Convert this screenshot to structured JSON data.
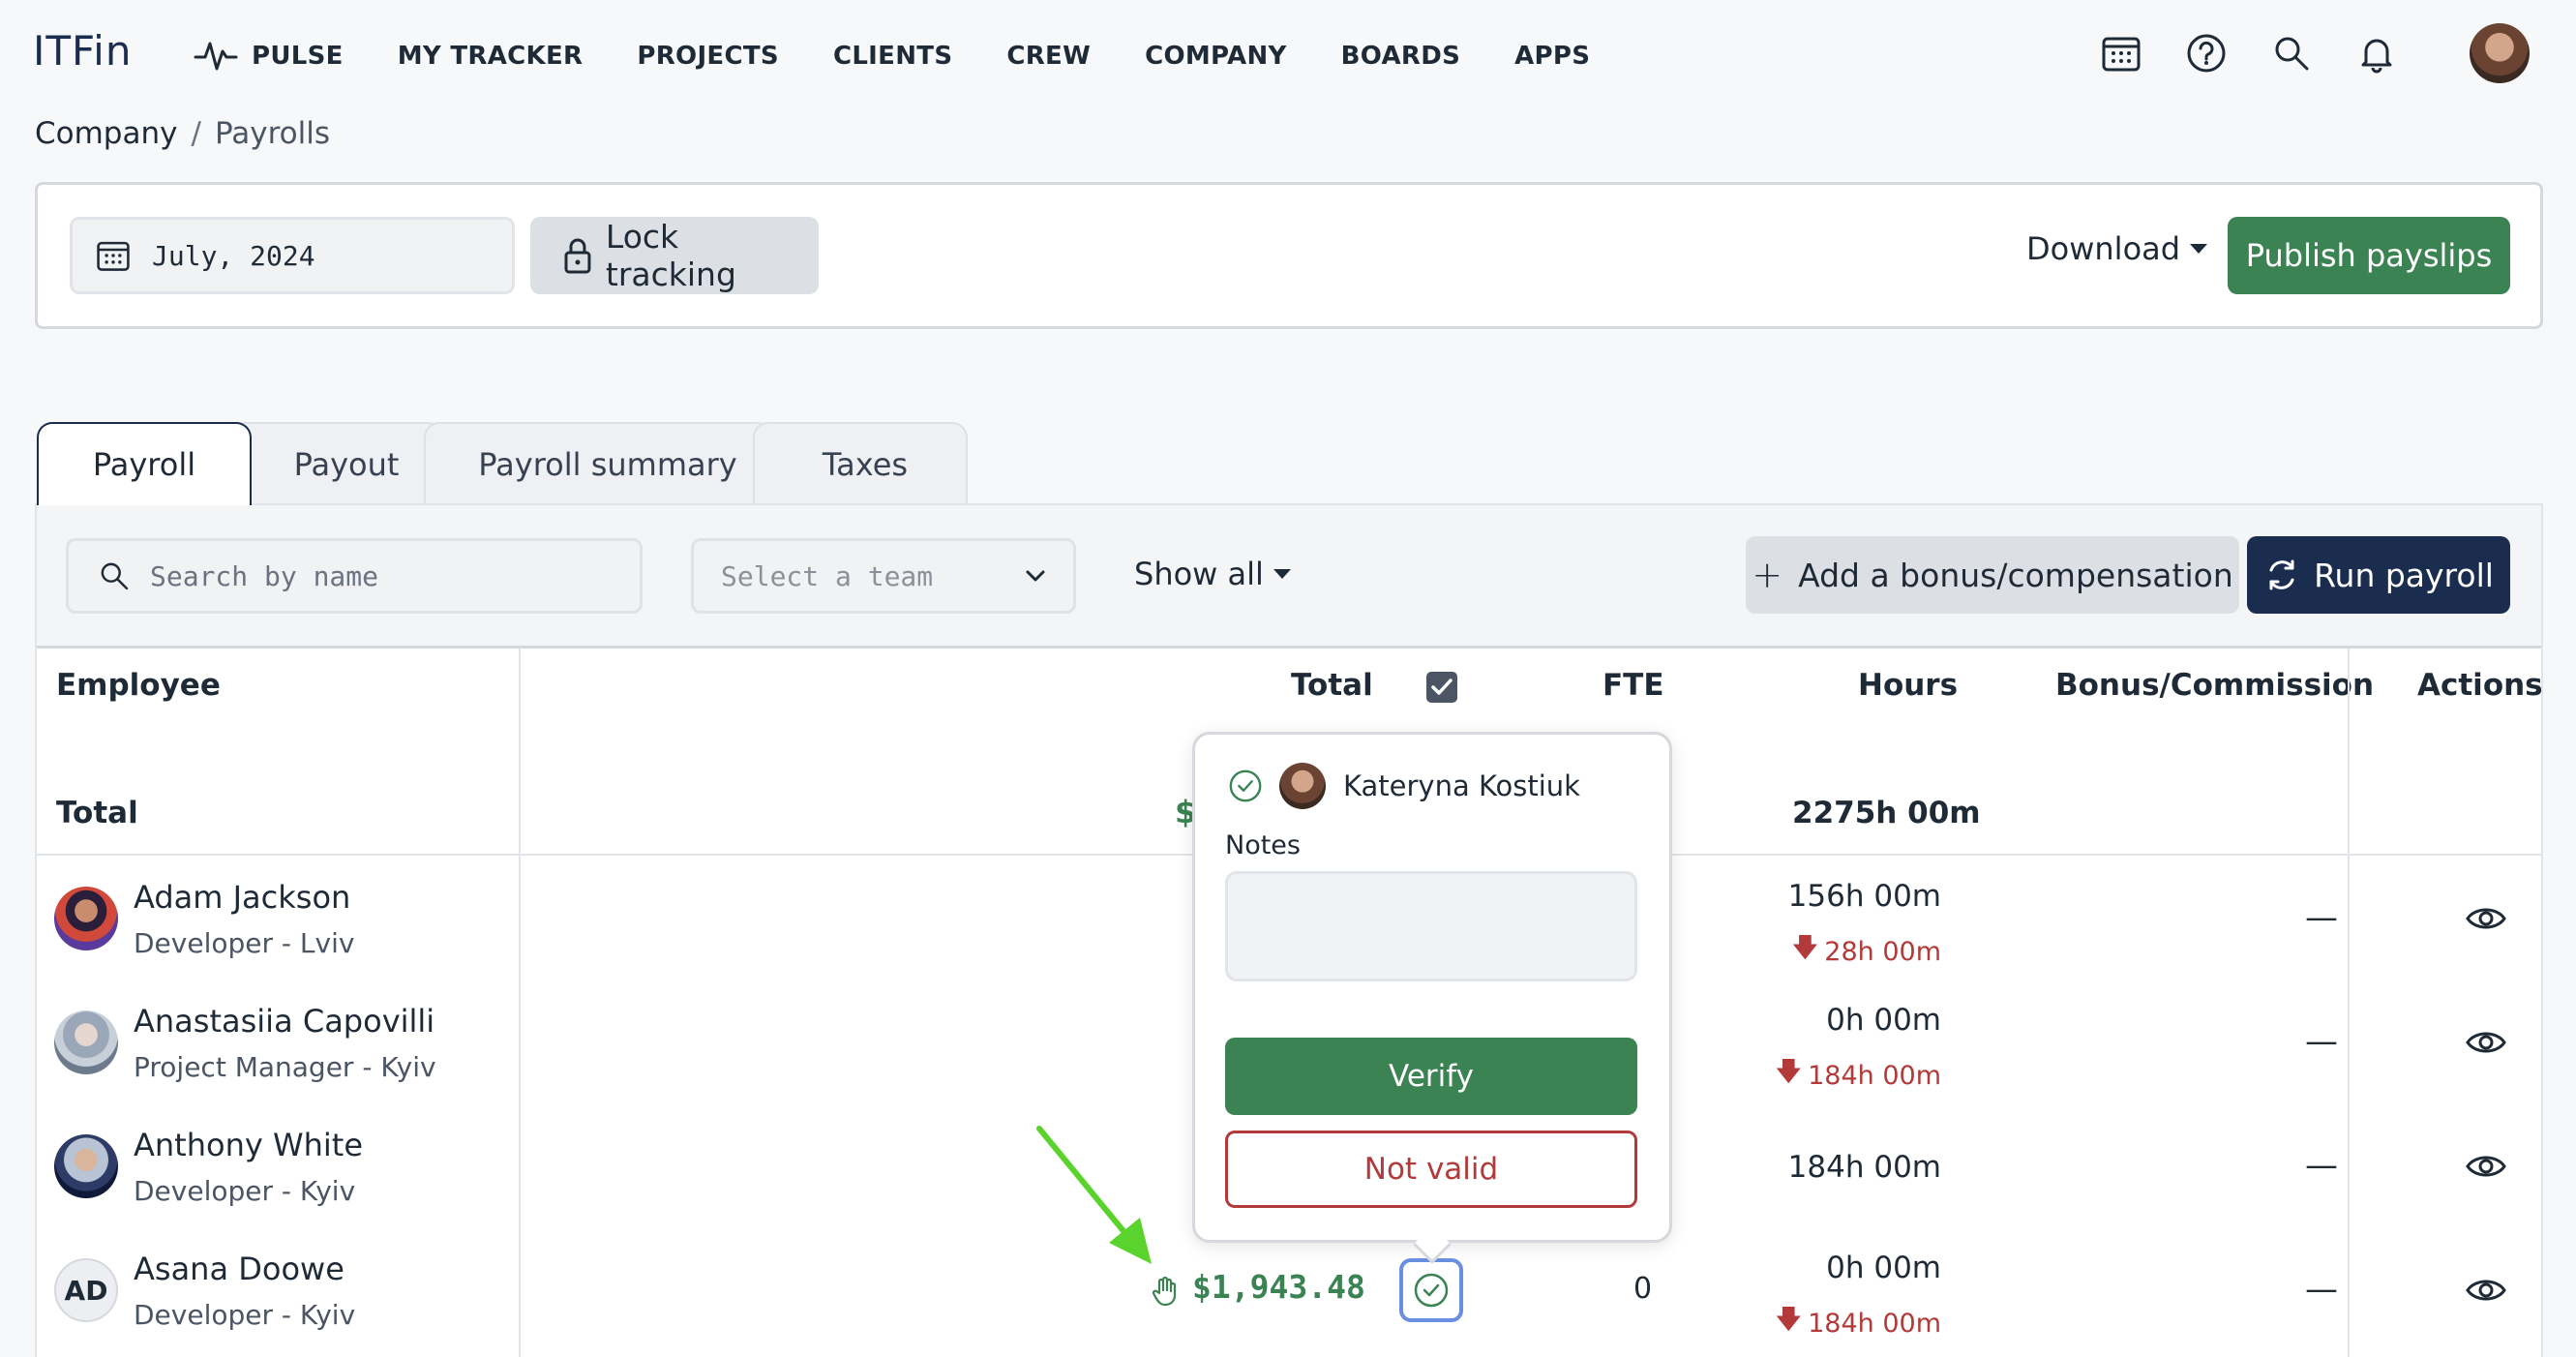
{
  "app": {
    "logo": "ITFin",
    "nav": [
      "PULSE",
      "MY TRACKER",
      "PROJECTS",
      "CLIENTS",
      "CREW",
      "COMPANY",
      "BOARDS",
      "APPS"
    ]
  },
  "breadcrumb": {
    "parent": "Company",
    "separator": "/",
    "current": "Payrolls"
  },
  "toolbar": {
    "date": "July, 2024",
    "lock_label": "Lock tracking",
    "download_label": "Download",
    "publish_label": "Publish payslips"
  },
  "tabs": [
    {
      "label": "Payroll",
      "active": true
    },
    {
      "label": "Payout",
      "active": false
    },
    {
      "label": "Payroll summary",
      "active": false
    },
    {
      "label": "Taxes",
      "active": false
    }
  ],
  "filters": {
    "search_placeholder": "Search by name",
    "team_placeholder": "Select a team",
    "show_all": "Show all",
    "add_bonus": "Add a bonus/compensation",
    "run_payroll": "Run payroll"
  },
  "table": {
    "headers": {
      "employee": "Employee",
      "total": "Total",
      "fte": "FTE",
      "hours": "Hours",
      "bonus": "Bonus/Commission",
      "actions": "Actions"
    },
    "total_row": {
      "label": "Total",
      "total_peek": "$",
      "hours": "2275h 00m"
    },
    "rows": [
      {
        "name": "Adam Jackson",
        "role": "Developer - Lviv",
        "hours": "156h 00m",
        "hours_diff": "28h 00m",
        "bonus": "—"
      },
      {
        "name": "Anastasiia Capovilli",
        "role": "Project Manager - Kyiv",
        "hours": "0h 00m",
        "hours_diff": "184h 00m",
        "bonus": "—"
      },
      {
        "name": "Anthony White",
        "role": "Developer - Kyiv",
        "hours": "184h 00m",
        "hours_diff": "",
        "bonus": "—"
      },
      {
        "name": "Asana Doowe",
        "initials": "AD",
        "role": "Developer - Kyiv",
        "total": "$1,943.48",
        "fte": "0",
        "hours": "0h 00m",
        "hours_diff": "184h 00m",
        "bonus": "—"
      }
    ]
  },
  "popover": {
    "user": "Kateryna Kostiuk",
    "notes_label": "Notes",
    "notes_value": "",
    "verify_label": "Verify",
    "not_valid_label": "Not valid"
  },
  "colors": {
    "primary": "#1b2d4f",
    "green": "#3b8352",
    "red": "#b33a3a",
    "highlight": "#6b8fe0"
  }
}
